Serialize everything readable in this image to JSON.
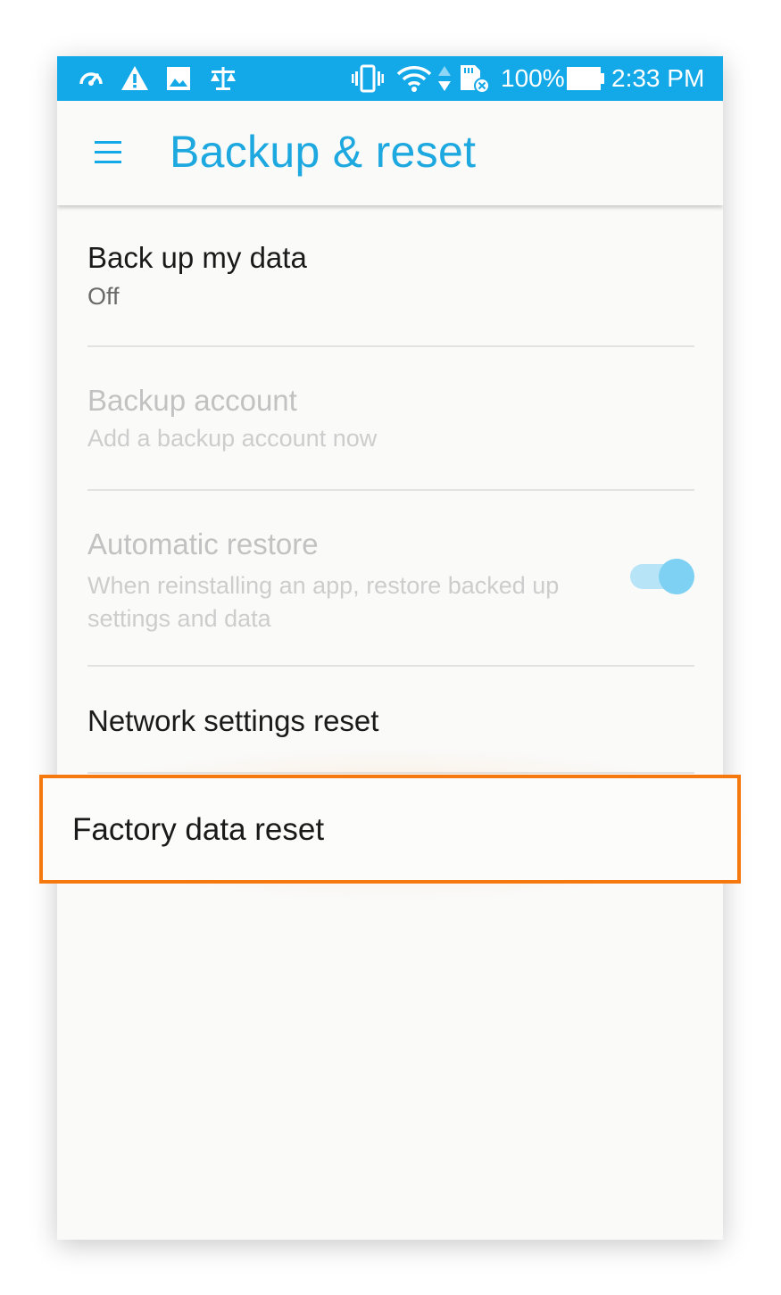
{
  "status_bar": {
    "battery": "100%",
    "time": "2:33 PM",
    "icons": [
      "speed-meter-icon",
      "warning-icon",
      "image-icon",
      "scale-icon",
      "vibrate-icon",
      "wifi-icon",
      "data-arrows-icon",
      "sd-card-icon"
    ],
    "background_color": "#13a9e8"
  },
  "app_bar": {
    "menu_icon": "hamburger-menu-icon",
    "title": "Backup & reset",
    "accent_color": "#1da8e0"
  },
  "settings": {
    "backup_data": {
      "title": "Back up my data",
      "summary": "Off"
    },
    "backup_account": {
      "title": "Backup account",
      "summary": "Add a backup account now"
    },
    "auto_restore": {
      "title": "Automatic restore",
      "summary": "When reinstalling an app, restore backed up settings and data",
      "enabled": true
    },
    "network_reset": {
      "title": "Network settings reset"
    },
    "factory_reset": {
      "title": "Factory data reset",
      "highlight_color": "#f5790f"
    }
  }
}
